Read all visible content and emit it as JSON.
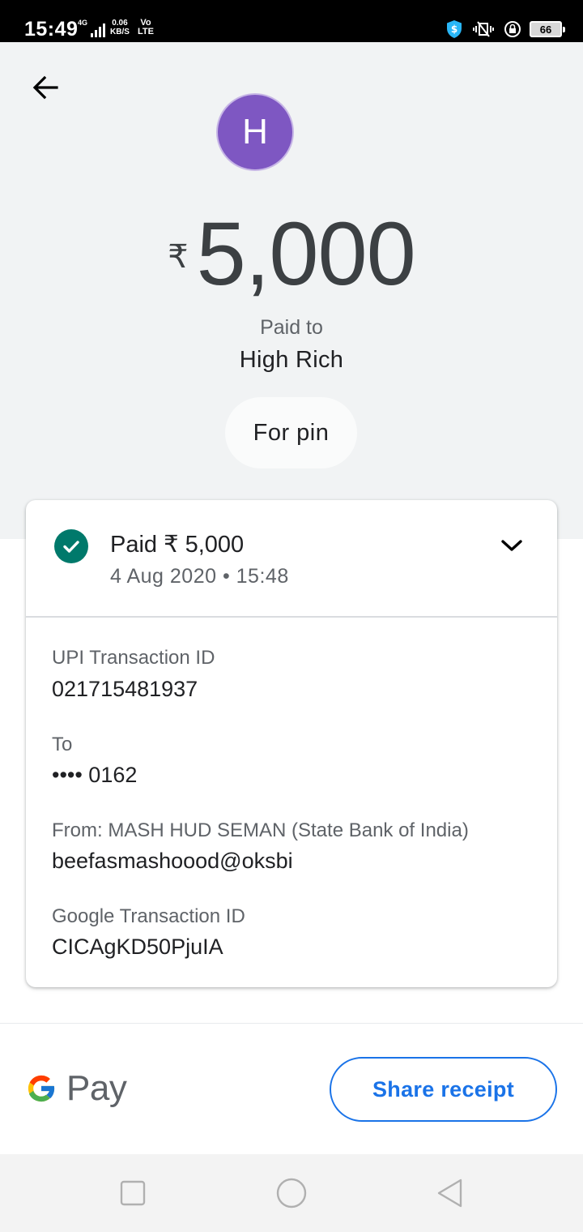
{
  "status_bar": {
    "time": "15:49",
    "network_type": "4G",
    "speed_value": "0.06",
    "speed_unit": "KB/S",
    "volte_top": "Vo",
    "volte_bottom": "LTE",
    "battery": "66"
  },
  "payment": {
    "avatar_letter": "H",
    "currency_symbol": "₹",
    "amount": "5,000",
    "paid_to_label": "Paid to",
    "payee_name": "High Rich",
    "note": "For pin"
  },
  "card": {
    "status": "Paid ₹ 5,000",
    "datetime": "4 Aug 2020 • 15:48",
    "status_color": "#00796b",
    "details": [
      {
        "label": "UPI Transaction ID",
        "value": "021715481937"
      },
      {
        "label": "To",
        "value": "•••• 0162"
      },
      {
        "label": "From: MASH HUD  SEMAN (State Bank of India)",
        "value": "beefasmashoood@oksbi"
      },
      {
        "label": "Google Transaction ID",
        "value": "CICAgKD50PjuIA"
      }
    ]
  },
  "footer": {
    "brand_text": "Pay",
    "share_label": "Share receipt",
    "accent_color": "#1a73e8"
  },
  "icons": {
    "back": "arrow-back-icon",
    "check": "check-circle-icon",
    "expand": "chevron-down-icon",
    "nav_recent": "square-icon",
    "nav_home": "circle-icon",
    "nav_back": "triangle-back-icon"
  }
}
